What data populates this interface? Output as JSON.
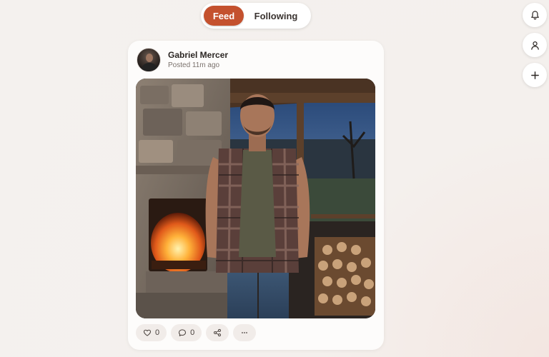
{
  "tabs": [
    {
      "label": "Feed",
      "active": true
    },
    {
      "label": "Following",
      "active": false
    }
  ],
  "rail": {
    "icons": [
      "bell-icon",
      "user-icon",
      "plus-icon"
    ]
  },
  "post": {
    "author": "Gabriel Mercer",
    "posted": "Posted 11m ago",
    "actions": {
      "likes": "0",
      "comments": "0"
    }
  },
  "colors": {
    "accent": "#c4512e",
    "background": "#f4f1ee",
    "card": "#fdfcfb"
  }
}
